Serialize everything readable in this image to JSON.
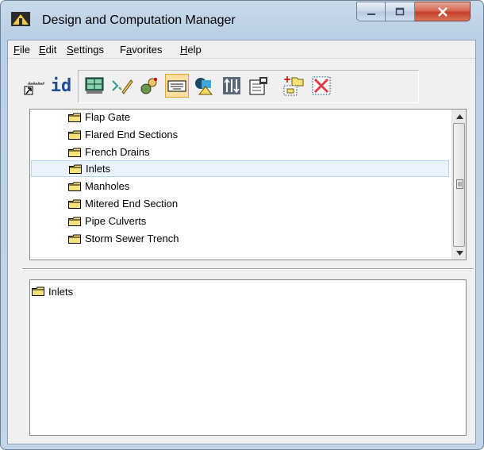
{
  "window": {
    "title": "Design and Computation Manager"
  },
  "menu": [
    {
      "label": "File",
      "key": "F",
      "rest": "ile"
    },
    {
      "label": "Edit",
      "key": "E",
      "rest": "dit"
    },
    {
      "label": "Settings",
      "key": "S",
      "rest": "ettings"
    },
    {
      "label": "Favorites",
      "key": "",
      "pre": "F",
      "keymid": "a",
      "rest": "vorites"
    },
    {
      "label": "Help",
      "key": "H",
      "rest": "elp"
    }
  ],
  "toolbar": {
    "id_label": "id"
  },
  "tree": {
    "items": [
      {
        "label": "Flap Gate"
      },
      {
        "label": "Flared End Sections"
      },
      {
        "label": "French Drains"
      },
      {
        "label": "Inlets",
        "selected": true
      },
      {
        "label": "Manholes"
      },
      {
        "label": "Mitered End Section"
      },
      {
        "label": "Pipe Culverts"
      },
      {
        "label": "Storm Sewer Trench"
      }
    ]
  },
  "bottom": {
    "item": "Inlets"
  },
  "colors": {
    "folder": "#f7e27a",
    "selection": "#eaf3fc",
    "close": "#c43e27"
  }
}
